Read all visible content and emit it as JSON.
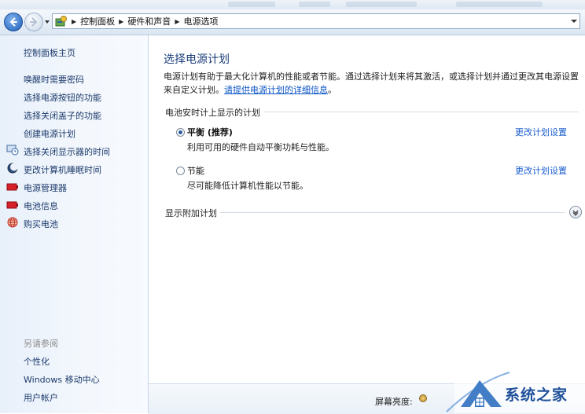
{
  "address_bar": {
    "breadcrumbs": [
      "控制面板",
      "硬件和声音",
      "电源选项"
    ]
  },
  "left_pane": {
    "home": "控制面板主页",
    "items": [
      {
        "label": "唤醒时需要密码",
        "icon": null
      },
      {
        "label": "选择电源按钮的功能",
        "icon": null
      },
      {
        "label": "选择关闭盖子的功能",
        "icon": null
      },
      {
        "label": "创建电源计划",
        "icon": null
      },
      {
        "label": "选择关闭显示器的时间",
        "icon": "monitor-clock-icon"
      },
      {
        "label": "更改计算机睡眠时间",
        "icon": "moon-icon"
      },
      {
        "label": "电源管理器",
        "icon": "battery-icon"
      },
      {
        "label": "电池信息",
        "icon": "battery-icon"
      },
      {
        "label": "购买电池",
        "icon": "globe-icon"
      }
    ],
    "see_also": {
      "heading": "另请参阅",
      "items": [
        "个性化",
        "Windows 移动中心",
        "用户帐户"
      ]
    }
  },
  "main": {
    "title": "选择电源计划",
    "description": "电源计划有助于最大化计算机的性能或者节能。通过选择计划来将其激活，或选择计划并通过更改其电源设置来自定义计划。",
    "description_link": "请提供电源计划的详细信息",
    "description_end": "。",
    "group_label": "电池安时计上显示的计划",
    "plans": [
      {
        "name": "平衡 (推荐)",
        "description": "利用可用的硬件自动平衡功耗与性能。",
        "selected": true,
        "change_link": "更改计划设置"
      },
      {
        "name": "节能",
        "description": "尽可能降低计算机性能以节能。",
        "selected": false,
        "change_link": "更改计划设置"
      }
    ],
    "additional_plans_label": "显示附加计划"
  },
  "bottom_bar": {
    "brightness_label": "屏幕亮度:"
  },
  "watermark": {
    "text": "系统之家"
  },
  "colors": {
    "link": "#1d5fcf",
    "title": "#1b3d7a",
    "left_pane_link": "#1c3a6b"
  }
}
